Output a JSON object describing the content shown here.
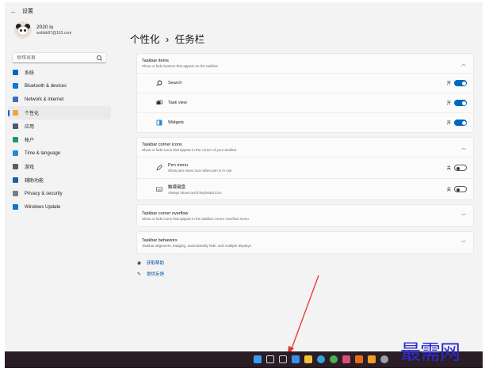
{
  "app": {
    "title": "设置",
    "back_icon": "back-arrow-icon"
  },
  "profile": {
    "name": "2020 lu",
    "email": "wxbbb97@163.com"
  },
  "search": {
    "placeholder": "查找设置"
  },
  "nav": {
    "items": [
      {
        "label": "系统",
        "icon": "system-icon",
        "color": "#0067c0",
        "active": false
      },
      {
        "label": "Bluetooth & devices",
        "icon": "bluetooth-icon",
        "color": "#0a78d4",
        "active": false
      },
      {
        "label": "Network & internet",
        "icon": "network-icon",
        "color": "#3b6fb6",
        "active": false
      },
      {
        "label": "个性化",
        "icon": "brush-icon",
        "color": "#f3a33a",
        "active": true
      },
      {
        "label": "应用",
        "icon": "apps-icon",
        "color": "#4d5a6b",
        "active": false
      },
      {
        "label": "帐户",
        "icon": "account-icon",
        "color": "#1a9b64",
        "active": false
      },
      {
        "label": "Time & language",
        "icon": "time-icon",
        "color": "#2a8ad1",
        "active": false
      },
      {
        "label": "游戏",
        "icon": "gaming-icon",
        "color": "#555d66",
        "active": false
      },
      {
        "label": "辅助功能",
        "icon": "accessibility-icon",
        "color": "#1b5fa8",
        "active": false
      },
      {
        "label": "Privacy & security",
        "icon": "shield-icon",
        "color": "#777d84",
        "active": false
      },
      {
        "label": "Windows Update",
        "icon": "update-icon",
        "color": "#0a78d4",
        "active": false
      }
    ]
  },
  "page": {
    "breadcrumb_parent": "个性化",
    "separator": "›",
    "breadcrumb_current": "任务栏"
  },
  "groups": {
    "taskbar_items": {
      "title": "Taskbar items",
      "desc": "Show or hide buttons that appear on the taskbar",
      "expanded": true,
      "rows": [
        {
          "label": "Search",
          "icon": "search-icon",
          "state": "开",
          "on": true
        },
        {
          "label": "Task view",
          "icon": "task-view-icon",
          "state": "开",
          "on": true
        },
        {
          "label": "Widgets",
          "icon": "widgets-icon",
          "state": "开",
          "on": true
        }
      ]
    },
    "corner_icons": {
      "title": "Taskbar corner icons",
      "desc": "Show or hide icons that appear in the corner of your taskbar",
      "expanded": true,
      "rows": [
        {
          "label": "Pen menu",
          "desc": "Show pen menu icon when pen is in use",
          "icon": "pen-icon",
          "state": "关",
          "on": false
        },
        {
          "label": "触摸键盘",
          "desc": "Always show touch keyboard icon",
          "icon": "keyboard-icon",
          "state": "关",
          "on": false
        }
      ]
    },
    "corner_overflow": {
      "title": "Taskbar corner overflow",
      "desc": "Show or hide icons that appear in the taskbar corner overflow menu",
      "expanded": false
    },
    "behaviors": {
      "title": "Taskbar behaviors",
      "desc": "Taskbar alignment, badging, automatically hide, and multiple displays",
      "expanded": false
    }
  },
  "help": {
    "get_help": "获取帮助",
    "feedback": "提供反馈"
  },
  "taskbar": {
    "icons": [
      {
        "name": "start-icon",
        "color": "#3a9bf0"
      },
      {
        "name": "search-icon",
        "color": "#dddddd"
      },
      {
        "name": "task-view-icon",
        "color": "#cccccc"
      },
      {
        "name": "widgets-icon",
        "color": "#3a8ee6"
      },
      {
        "name": "file-explorer-icon",
        "color": "#f2c037"
      },
      {
        "name": "edge-icon",
        "color": "#2fa6d8"
      },
      {
        "name": "chrome-icon",
        "color": "#4caf50"
      },
      {
        "name": "app-icon",
        "color": "#d94c7a"
      },
      {
        "name": "app-icon",
        "color": "#e86b1c"
      },
      {
        "name": "app-icon",
        "color": "#f0a020"
      },
      {
        "name": "settings-icon",
        "color": "#9aa0a6"
      }
    ]
  },
  "watermark": "最需网",
  "accent_color": "#0067c0"
}
